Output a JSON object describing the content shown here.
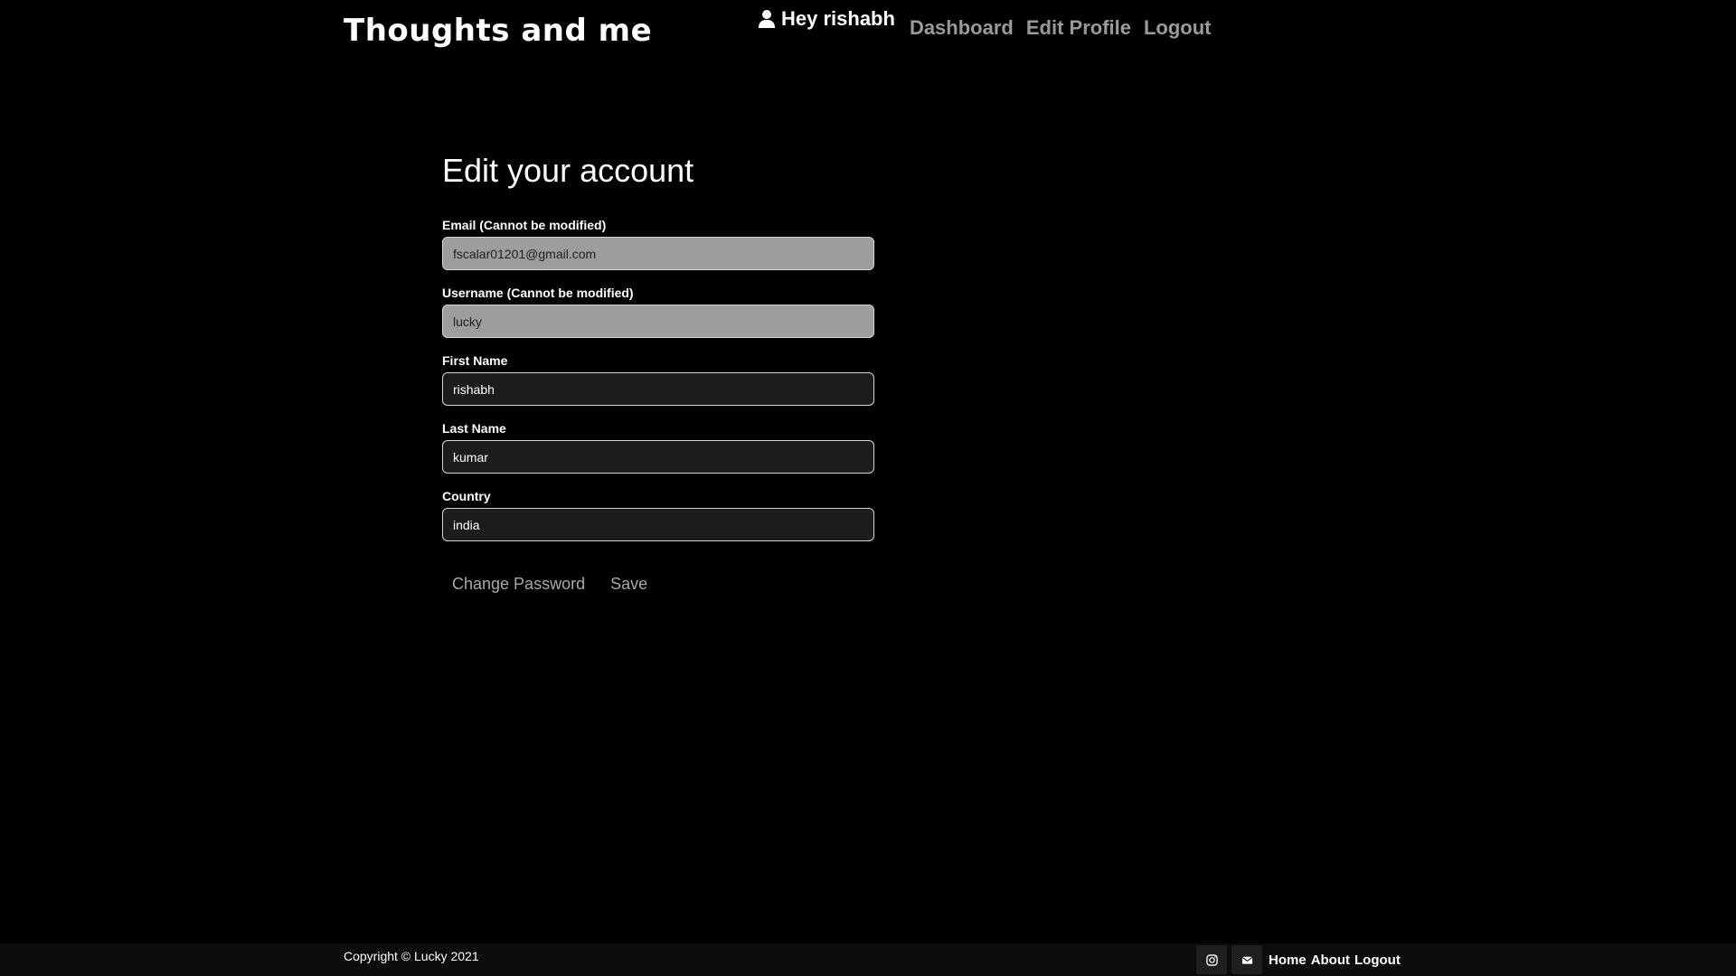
{
  "header": {
    "brand": "Thoughts and me",
    "greeting": "Hey rishabh",
    "user_icon": "user-icon",
    "nav": [
      "Dashboard",
      "Edit Profile",
      "Logout"
    ]
  },
  "form": {
    "title": "Edit your account",
    "fields": [
      {
        "label": "Email (Cannot be modified)",
        "value": "fscalar01201@gmail.com",
        "readonly": true
      },
      {
        "label": "Username (Cannot be modified)",
        "value": "lucky",
        "readonly": true
      },
      {
        "label": "First Name",
        "value": "rishabh",
        "readonly": false
      },
      {
        "label": "Last Name",
        "value": "kumar",
        "readonly": false
      },
      {
        "label": "Country",
        "value": "india",
        "readonly": false
      }
    ],
    "change_password_label": "Change Password",
    "save_label": "Save"
  },
  "footer": {
    "copyright": "Copyright © Lucky 2021",
    "icons": [
      "instagram-icon",
      "envelope-icon"
    ],
    "links": [
      "Home",
      "About",
      "Logout"
    ]
  },
  "colors": {
    "background": "#000000",
    "nav_link": "#9a9a9a",
    "readonly_input": "#9d9d9d",
    "editable_input": "#1c1c1c"
  }
}
